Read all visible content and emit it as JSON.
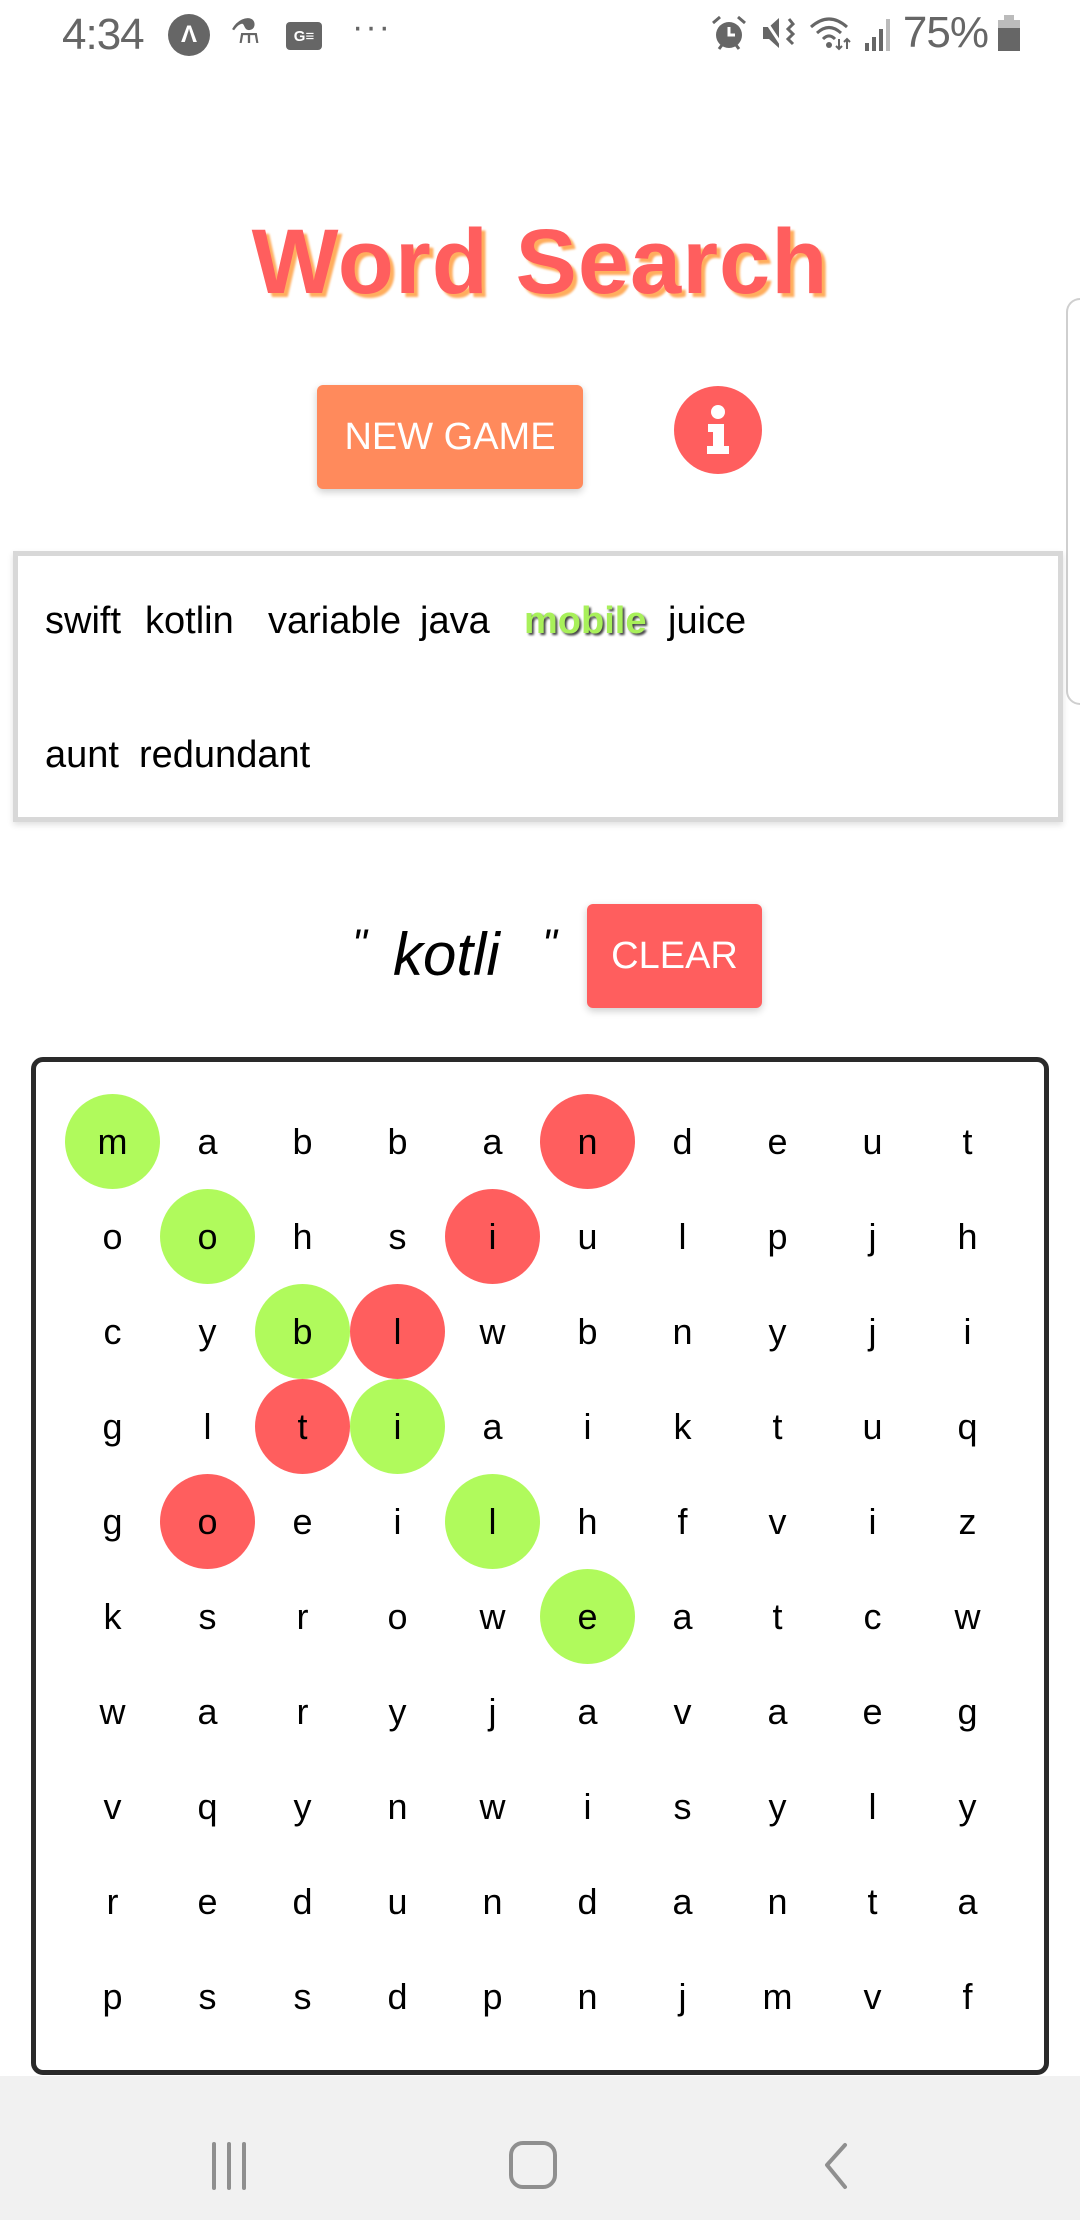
{
  "status_bar": {
    "time": "4:34",
    "left_icons": [
      "app-a-icon",
      "accessibility-icon",
      "news-icon",
      "more-dots-icon"
    ],
    "right_icons": [
      "alarm-icon",
      "mute-vibrate-icon",
      "wifi-icon",
      "signal-icon"
    ],
    "battery_percent": "75%",
    "battery_level": 0.75
  },
  "header": {
    "title": "Word Search",
    "new_game_label": "NEW GAME",
    "info_icon": "info-icon"
  },
  "colors": {
    "title": "#FF5E5E",
    "title_shadow": "#FFAE5E",
    "new_game_bg": "#FF8A5C",
    "clear_bg": "#FF5E5E",
    "found_highlight": "#B0FA5C",
    "selected_highlight": "#FF5E5E",
    "found_word_text": "#A8F05A"
  },
  "word_list": [
    {
      "word": "swift",
      "found": false
    },
    {
      "word": "kotlin",
      "found": false
    },
    {
      "word": "variable",
      "found": false
    },
    {
      "word": "java",
      "found": false
    },
    {
      "word": "mobile",
      "found": true
    },
    {
      "word": "juice",
      "found": false
    },
    {
      "word": "aunt",
      "found": false
    },
    {
      "word": "redundant",
      "found": false
    }
  ],
  "selection": {
    "open_quote": "\"",
    "current": "kotli",
    "close_quote": "\"",
    "clear_label": "CLEAR"
  },
  "grid": {
    "rows": [
      [
        "m",
        "a",
        "b",
        "b",
        "a",
        "n",
        "d",
        "e",
        "u",
        "t"
      ],
      [
        "o",
        "o",
        "h",
        "s",
        "i",
        "u",
        "l",
        "p",
        "j",
        "h"
      ],
      [
        "c",
        "y",
        "b",
        "l",
        "w",
        "b",
        "n",
        "y",
        "j",
        "i"
      ],
      [
        "g",
        "l",
        "t",
        "i",
        "a",
        "i",
        "k",
        "t",
        "u",
        "q"
      ],
      [
        "g",
        "o",
        "e",
        "i",
        "l",
        "h",
        "f",
        "v",
        "i",
        "z"
      ],
      [
        "k",
        "s",
        "r",
        "o",
        "w",
        "e",
        "a",
        "t",
        "c",
        "w"
      ],
      [
        "w",
        "a",
        "r",
        "y",
        "j",
        "a",
        "v",
        "a",
        "e",
        "g"
      ],
      [
        "v",
        "q",
        "y",
        "n",
        "w",
        "i",
        "s",
        "y",
        "l",
        "y"
      ],
      [
        "r",
        "e",
        "d",
        "u",
        "n",
        "d",
        "a",
        "n",
        "t",
        "a"
      ],
      [
        "p",
        "s",
        "s",
        "d",
        "p",
        "n",
        "j",
        "m",
        "v",
        "f"
      ]
    ],
    "found_cells": [
      [
        0,
        0
      ],
      [
        1,
        1
      ],
      [
        2,
        2
      ],
      [
        3,
        3
      ],
      [
        4,
        4
      ],
      [
        5,
        5
      ]
    ],
    "selected_cells": [
      [
        5,
        0
      ],
      [
        4,
        1
      ],
      [
        3,
        2
      ],
      [
        2,
        3
      ],
      [
        1,
        4
      ]
    ]
  },
  "nav_bar": {
    "buttons": [
      "recent-apps-icon",
      "home-icon",
      "back-icon"
    ]
  }
}
